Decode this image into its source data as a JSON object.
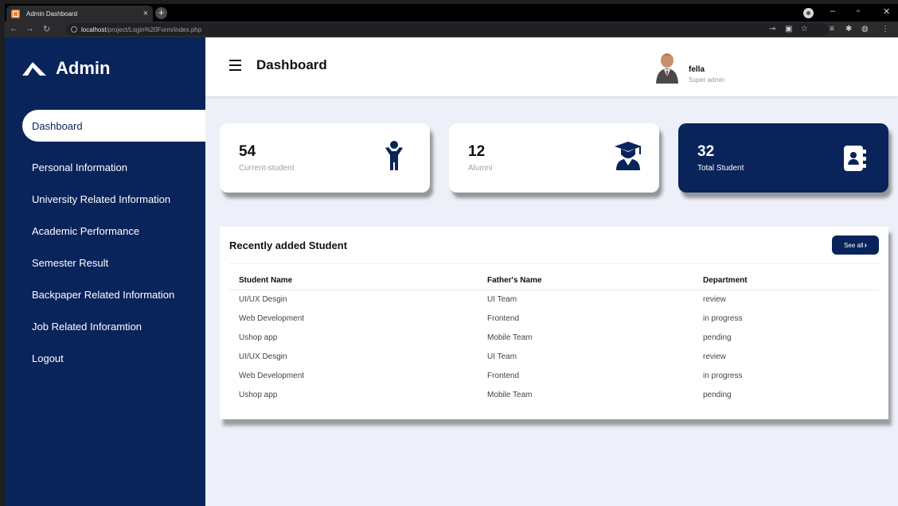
{
  "browser": {
    "tab_title": "Admin Dashboard",
    "url_host": "localhost",
    "url_path": "/project/Login%20Form/index.php"
  },
  "sidebar": {
    "brand": "Admin",
    "items": [
      {
        "label": "Dashboard",
        "active": true
      },
      {
        "label": "Personal Information"
      },
      {
        "label": "University Related Information"
      },
      {
        "label": "Academic Performance"
      },
      {
        "label": "Semester Result"
      },
      {
        "label": "Backpaper Related Information"
      },
      {
        "label": "Job Related Inforamtion"
      },
      {
        "label": "Logout"
      }
    ]
  },
  "header": {
    "title": "Dashboard",
    "user": {
      "name": "fella",
      "role": "Super admin"
    }
  },
  "cards": [
    {
      "value": "54",
      "label": "Current-student",
      "icon": "child-icon"
    },
    {
      "value": "12",
      "label": "Alumni",
      "icon": "graduate-icon"
    },
    {
      "value": "32",
      "label": "Total Student",
      "icon": "address-book-icon"
    }
  ],
  "recent": {
    "title": "Recently added Student",
    "see_all": "See all",
    "columns": [
      "Student Name",
      "Father's Name",
      "Department"
    ],
    "rows": [
      [
        "UI/UX Desgin",
        "UI Team",
        "review"
      ],
      [
        "Web Development",
        "Frontend",
        "in progress"
      ],
      [
        "Ushop app",
        "Mobile Team",
        "pending"
      ],
      [
        "UI/UX Desgin",
        "UI Team",
        "review"
      ],
      [
        "Web Development",
        "Frontend",
        "in progress"
      ],
      [
        "Ushop app",
        "Mobile Team",
        "pending"
      ]
    ]
  },
  "colors": {
    "navy": "#08245a",
    "page_bg": "#eef0f9"
  }
}
